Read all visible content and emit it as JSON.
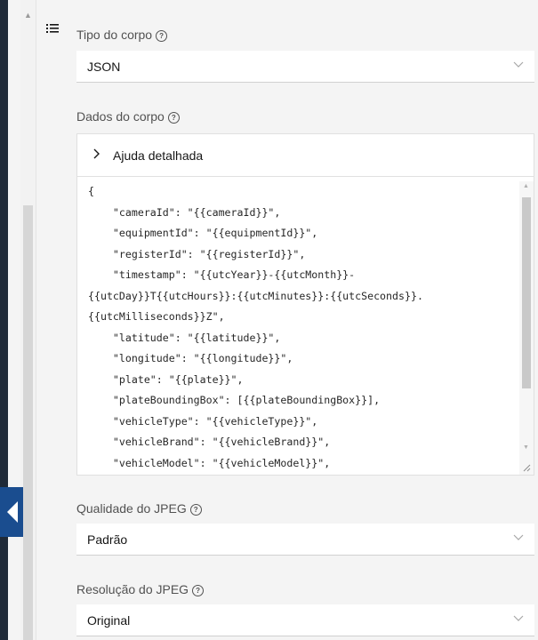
{
  "body_type": {
    "label": "Tipo do corpo",
    "value": "JSON"
  },
  "body_data": {
    "label": "Dados do corpo",
    "help_toggle": "Ajuda detalhada",
    "code": "{\n    \"cameraId\": \"{{cameraId}}\",\n    \"equipmentId\": \"{{equipmentId}}\",\n    \"registerId\": \"{{registerId}}\",\n    \"timestamp\": \"{{utcYear}}-{{utcMonth}}-\n{{utcDay}}T{{utcHours}}:{{utcMinutes}}:{{utcSeconds}}.\n{{utcMilliseconds}}Z\",\n    \"latitude\": \"{{latitude}}\",\n    \"longitude\": \"{{longitude}}\",\n    \"plate\": \"{{plate}}\",\n    \"plateBoundingBox\": [{{plateBoundingBox}}],\n    \"vehicleType\": \"{{vehicleType}}\",\n    \"vehicleBrand\": \"{{vehicleBrand}}\",\n    \"vehicleModel\": \"{{vehicleModel}}\","
  },
  "jpeg_quality": {
    "label": "Qualidade do JPEG",
    "value": "Padrão"
  },
  "jpeg_resolution": {
    "label": "Resolução do JPEG",
    "value": "Original"
  },
  "icons": {
    "help": "?",
    "list": "list-icon",
    "chevron": "chevron-down-icon",
    "collapse": "chevron-left-icon"
  },
  "colors": {
    "rail": "#1f2a38",
    "collapse_tab": "#1a4d8f",
    "field_bg": "#ffffff",
    "panel_bg": "#f4f4f4"
  }
}
